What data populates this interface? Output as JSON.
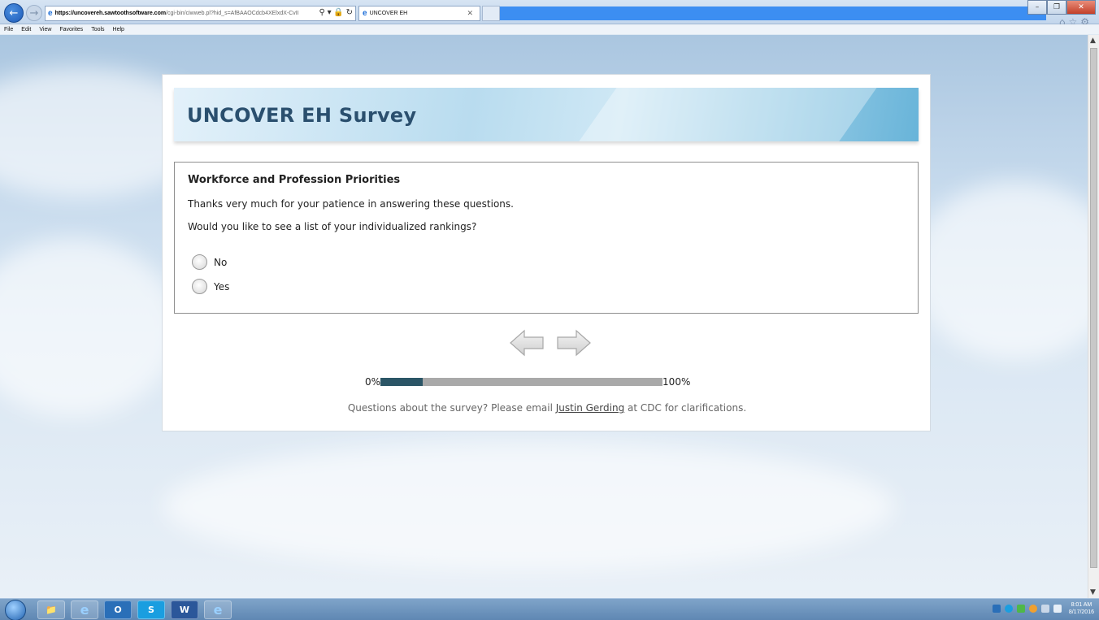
{
  "browser": {
    "address_host": "https://uncovereh.sawtoothsoftware.com",
    "address_path": "/cgi-bin/ciwweb.pl?hid_s=AfBAAOCdcb4XElxdX-CvII",
    "tab_title": "UNCOVER EH",
    "menu": [
      "File",
      "Edit",
      "View",
      "Favorites",
      "Tools",
      "Help"
    ]
  },
  "survey": {
    "title": "UNCOVER EH Survey",
    "section_heading": "Workforce and Profession Priorities",
    "text1": "Thanks very much for your patience in answering these questions.",
    "text2": "Would you like to see a list of your individualized rankings?",
    "options": [
      "No",
      "Yes"
    ],
    "progress_start": "0%",
    "progress_end": "100%",
    "progress_fraction": 0.15,
    "footer_before": "Questions about the survey? Please email ",
    "footer_link": "Justin Gerding",
    "footer_after": " at CDC for clarifications."
  },
  "taskbar": {
    "apps": [
      "O",
      "S",
      "W",
      "e"
    ],
    "time": "8:01 AM",
    "date": "8/17/2016"
  }
}
